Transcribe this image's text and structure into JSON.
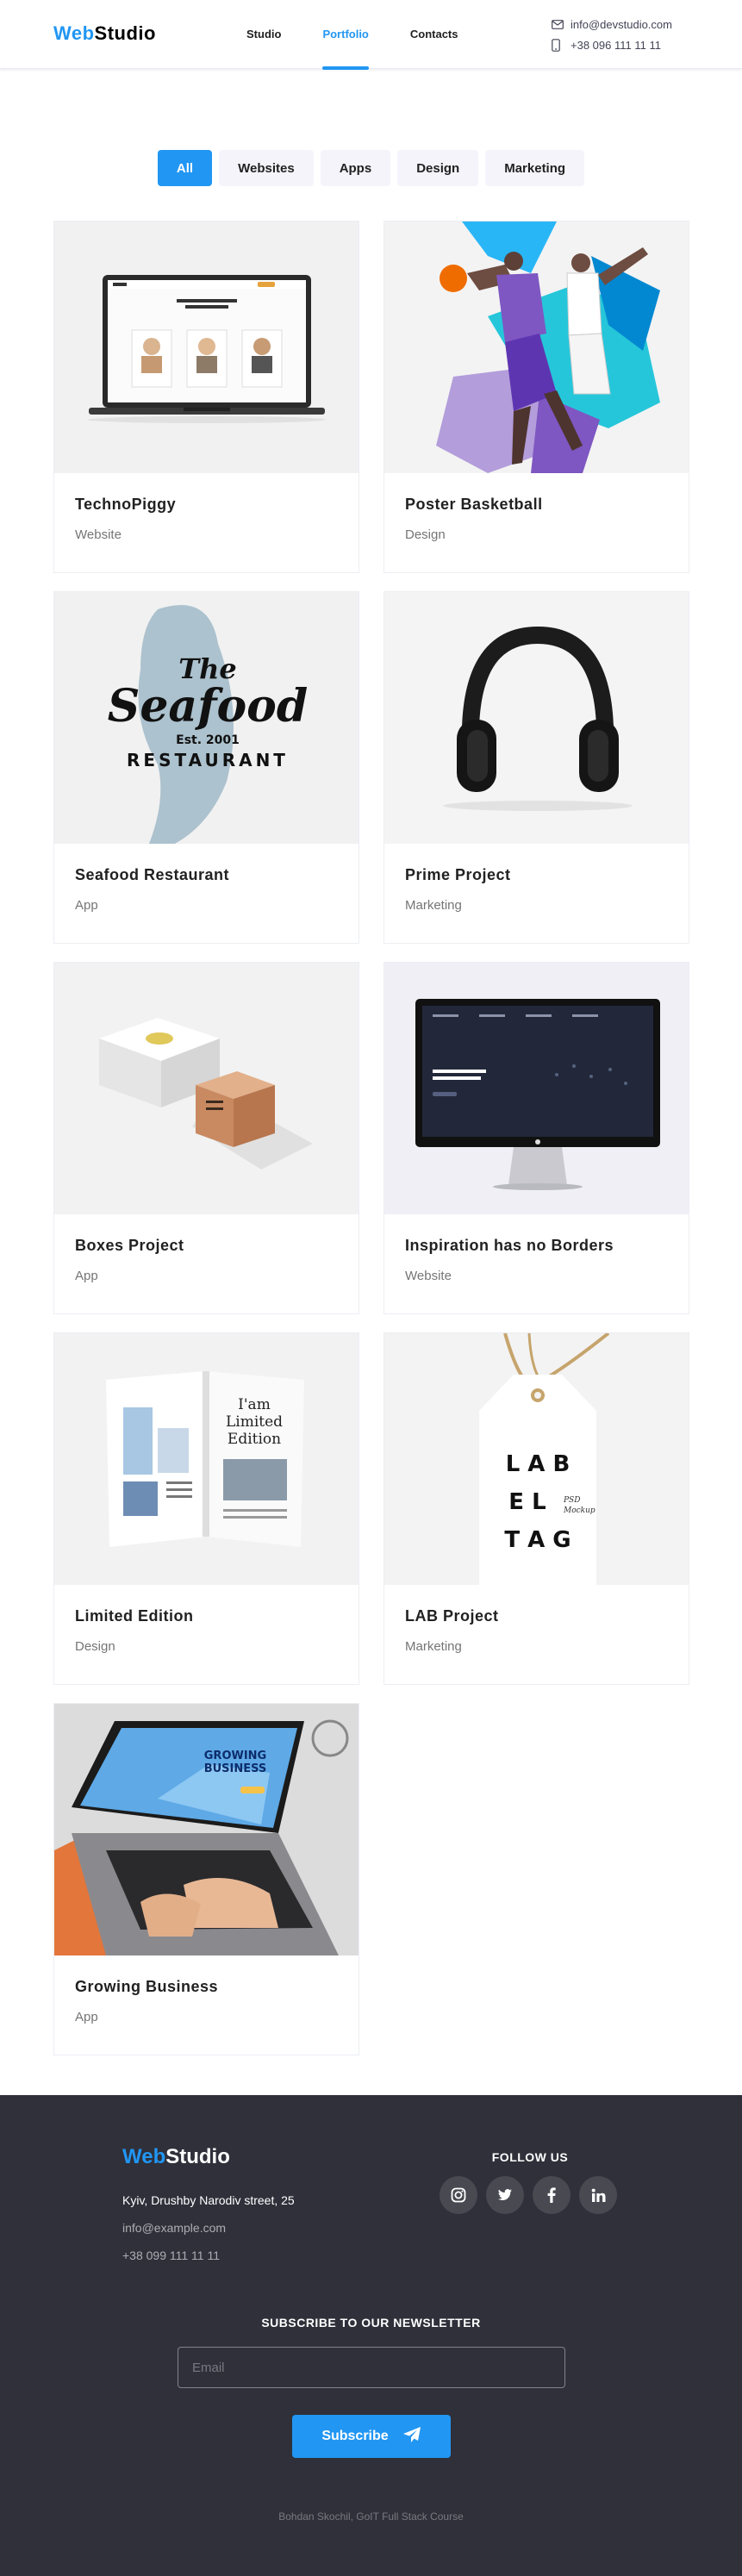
{
  "header": {
    "logo_part1": "Web",
    "logo_part2": "Studio",
    "nav": [
      "Studio",
      "Portfolio",
      "Contacts"
    ],
    "email": "info@devstudio.com",
    "phone": "+38 096 111 11 11"
  },
  "filters": [
    "All",
    "Websites",
    "Apps",
    "Design",
    "Marketing"
  ],
  "projects": [
    {
      "title": "TechnoPiggy",
      "category": "Website",
      "image": "laptop-mockup"
    },
    {
      "title": "Poster Basketball",
      "category": "Design",
      "image": "basketball-poster"
    },
    {
      "title": "Seafood Restaurant",
      "category": "App",
      "image": "seafood-logo"
    },
    {
      "title": "Prime Project",
      "category": "Marketing",
      "image": "headphones"
    },
    {
      "title": "Boxes Project",
      "category": "App",
      "image": "boxes"
    },
    {
      "title": "Inspiration has no Borders",
      "category": "Website",
      "image": "monitor-mockup"
    },
    {
      "title": "Limited Edition",
      "category": "Design",
      "image": "magazine"
    },
    {
      "title": "LAB Project",
      "category": "Marketing",
      "image": "label-tag"
    },
    {
      "title": "Growing Business",
      "category": "App",
      "image": "laptop-hands"
    }
  ],
  "image_text": {
    "seafood_the": "The",
    "seafood_name": "Seafood",
    "seafood_est": "Est. 2001",
    "seafood_restaurant": "RESTAURANT",
    "tag_line1": "L A B",
    "tag_line2": "E L",
    "tag_line3": "T A G",
    "tag_psd": "PSD",
    "tag_mockup": "Mockup",
    "magazine_line1": "I'am",
    "magazine_line2": "Limited",
    "magazine_line3": "Edition",
    "laptop_screen1": "GROWING",
    "laptop_screen2": "BUSINESS"
  },
  "footer": {
    "logo_part1": "Web",
    "logo_part2": "Studio",
    "address": "Kyiv, Drushby Narodiv street, 25",
    "email": "info@example.com",
    "phone": "+38 099 111 11 11",
    "follow_title": "FOLLOW US",
    "social_icons": [
      "instagram-icon",
      "twitter-icon",
      "facebook-icon",
      "linkedin-icon"
    ],
    "newsletter_title": "SUBSCRIBE TO OUR NEWSLETTER",
    "email_placeholder": "Email",
    "subscribe_label": "Subscribe",
    "copyright": "Bohdan Skochil, GoIT Full Stack Course"
  },
  "colors": {
    "accent": "#2196f3",
    "footer_bg": "#2f303a",
    "filter_bg": "#f5f4fa",
    "text": "#212121",
    "muted": "#757575"
  }
}
